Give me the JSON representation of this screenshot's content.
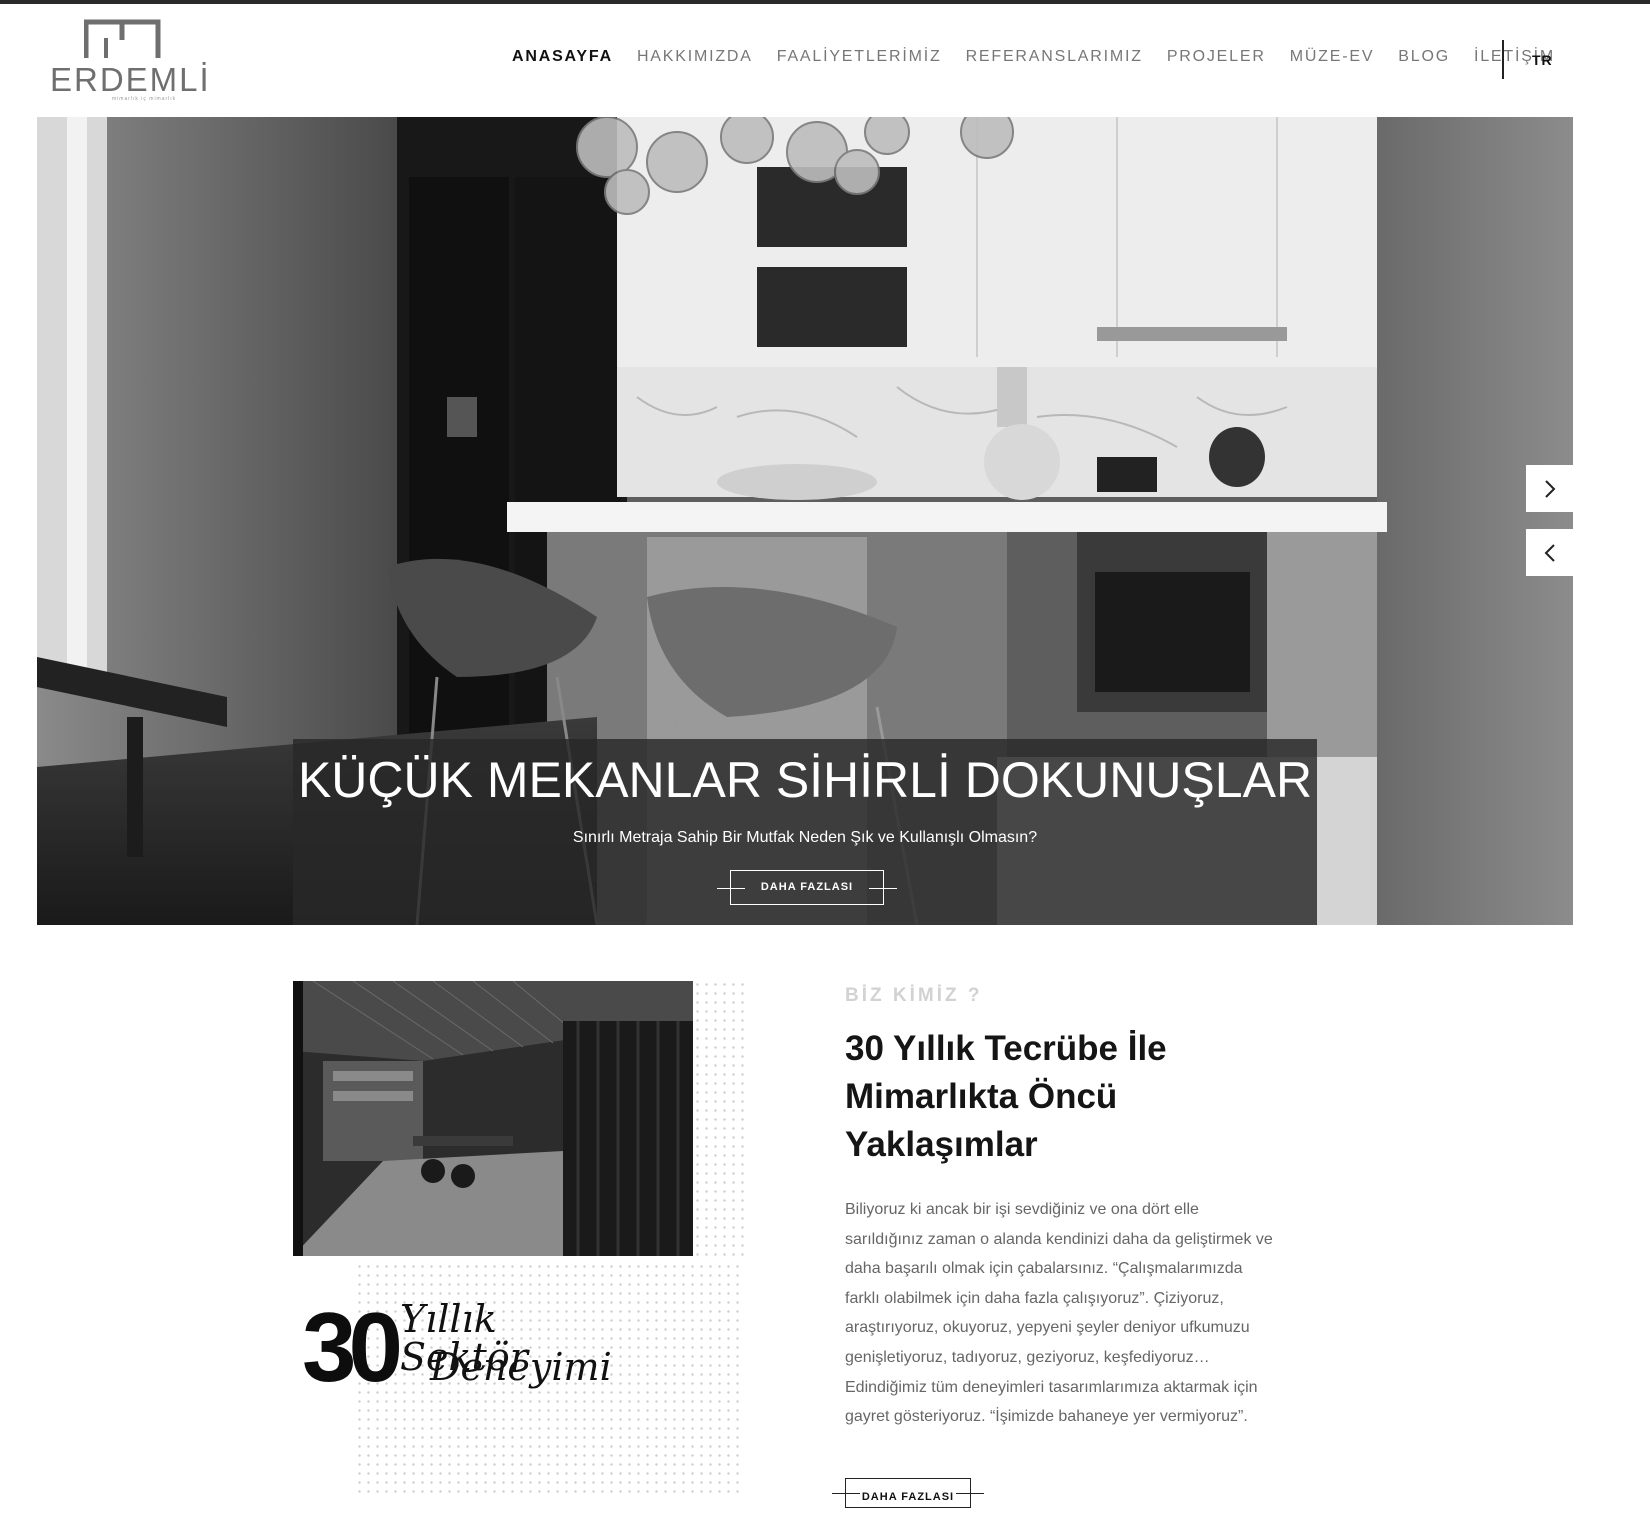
{
  "brand": {
    "name": "ERDEMLİ",
    "tagline": "mimarlık iç mimarlık"
  },
  "nav": {
    "items": [
      {
        "label": "ANASAYFA",
        "active": true
      },
      {
        "label": "HAKKIMIZDA",
        "active": false
      },
      {
        "label": "FAALİYETLERİMİZ",
        "active": false
      },
      {
        "label": "REFERANSLARIMIZ",
        "active": false
      },
      {
        "label": "PROJELER",
        "active": false
      },
      {
        "label": "MÜZE-EV",
        "active": false
      },
      {
        "label": "BLOG",
        "active": false
      },
      {
        "label": "İLETİŞİM",
        "active": false
      }
    ],
    "language": "TR"
  },
  "hero": {
    "title": "KÜÇÜK MEKANLAR SİHİRLİ DOKUNUŞLAR",
    "subtitle": "Sınırlı Metraja Sahip Bir Mutfak Neden Şık ve Kullanışlı Olmasın?",
    "button_label": "DAHA FAZLASI",
    "image_alt": "kitchen-photo"
  },
  "about": {
    "eyebrow": "BİZ KİMİZ ?",
    "title": "30 Yıllık Tecrübe İle Mimarlıkta Öncü Yaklaşımlar",
    "body": "Biliyoruz ki ancak bir işi sevdiğiniz ve ona dört elle sarıldığınız zaman o alanda kendinizi daha da geliştirmek ve daha başarılı olmak için çabalarsınız. “Çalışmalarımızda farklı olabilmek için daha fazla çalışıyoruz”. Çiziyoruz, araştırıyoruz, okuyoruz, yepyeni şeyler deniyor ufkumuzu genişletiyoruz, tadıyoruz, geziyoruz, keşfediyoruz… Edindiğimiz tüm deneyimleri tasarımlarımıza aktarmak için gayret gösteriyoruz. “İşimizde bahaneye yer vermiyoruz”.",
    "button_label": "DAHA FAZLASI",
    "experience": {
      "number": "30",
      "line1": "Yıllık Sektör",
      "line2": "Deneyimi"
    }
  }
}
